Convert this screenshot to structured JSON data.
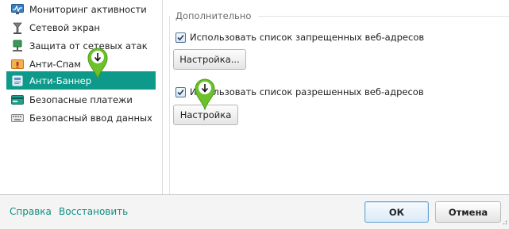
{
  "sidebar": {
    "items": [
      {
        "label": "Мониторинг активности",
        "icon": "activity-monitor-icon",
        "selected": false
      },
      {
        "label": "Сетевой экран",
        "icon": "firewall-icon",
        "selected": false
      },
      {
        "label": "Защита от сетевых атак",
        "icon": "network-attack-icon",
        "selected": false
      },
      {
        "label": "Анти-Спам",
        "icon": "anti-spam-icon",
        "selected": false
      },
      {
        "label": "Анти-Баннер",
        "icon": "anti-banner-icon",
        "selected": true
      },
      {
        "label": "Безопасные платежи",
        "icon": "safe-money-icon",
        "selected": false
      },
      {
        "label": "Безопасный ввод данных",
        "icon": "keyboard-icon",
        "selected": false
      }
    ]
  },
  "settings": {
    "group_title": "Дополнительно",
    "blocked_list": {
      "label": "Использовать список запрещенных веб-адресов",
      "checked": true,
      "button": "Настройка..."
    },
    "allowed_list": {
      "label": "Использовать список разрешенных веб-адресов",
      "checked": true,
      "button": "Настройка"
    }
  },
  "footer": {
    "help_link": "Справка",
    "restore_link": "Восстановить",
    "ok_button": "ОК",
    "cancel_button": "Отмена"
  },
  "colors": {
    "selected_bg": "#0e9a8a",
    "link": "#0e8f80",
    "marker": "#6cc22a"
  }
}
